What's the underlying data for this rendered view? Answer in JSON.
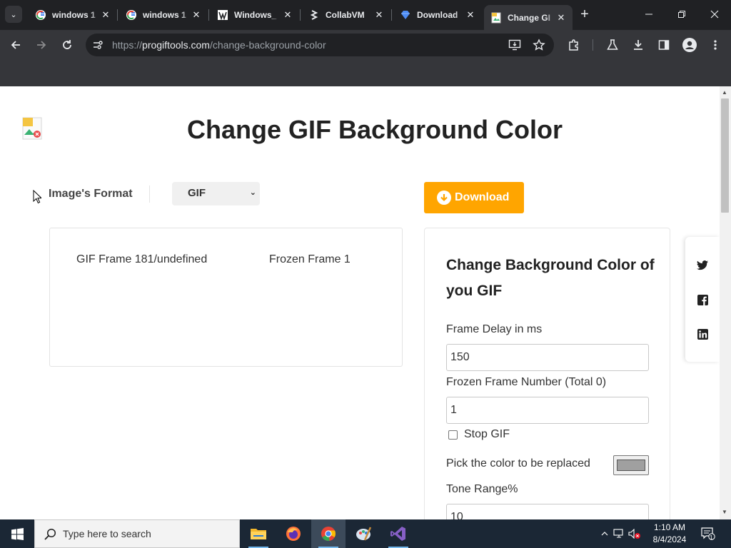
{
  "browser": {
    "tabs": [
      {
        "title": "windows 1",
        "favicon": "google-icon"
      },
      {
        "title": "windows 1",
        "favicon": "google-icon"
      },
      {
        "title": "Windows_",
        "favicon": "windows-logo-icon"
      },
      {
        "title": "CollabVM",
        "favicon": "collabvm-icon"
      },
      {
        "title": "Download",
        "favicon": "diamond-icon"
      },
      {
        "title": "Change GI",
        "favicon": "progiftools-icon"
      }
    ],
    "active_tab_index": 5,
    "url_prefix": "https://",
    "url_domain": "progiftools.com",
    "url_path": "/change-background-color"
  },
  "page": {
    "title": "Change GIF Background Color",
    "format_label": "Image's Format",
    "format_value": "GIF",
    "download_label": "Download",
    "frames": {
      "gif_frame_label": "GIF Frame 181/undefined",
      "frozen_frame_label": "Frozen Frame 1"
    },
    "panel": {
      "heading": "Change Background Color of you GIF",
      "frame_delay_label": "Frame Delay in ms",
      "frame_delay_value": "150",
      "frozen_frame_label": "Frozen Frame Number (Total 0)",
      "frozen_frame_value": "1",
      "stop_gif_label": "Stop GIF",
      "stop_gif_checked": false,
      "pick_color_label": "Pick the color to be replaced",
      "picked_color": "#a0a0a0",
      "tone_range_label": "Tone Range%",
      "tone_range_value": "10"
    },
    "social": [
      "twitter-icon",
      "facebook-icon",
      "linkedin-icon"
    ]
  },
  "taskbar": {
    "search_placeholder": "Type here to search",
    "apps": [
      "file-explorer-icon",
      "firefox-icon",
      "chrome-icon",
      "paint-icon",
      "visual-studio-icon"
    ],
    "time": "1:10 AM",
    "date": "8/4/2024",
    "notification_count": "1"
  },
  "colors": {
    "accent_orange": "#ffa500",
    "chrome_dark": "#202124",
    "chrome_toolbar": "#35363a",
    "taskbar": "#1b2735"
  }
}
